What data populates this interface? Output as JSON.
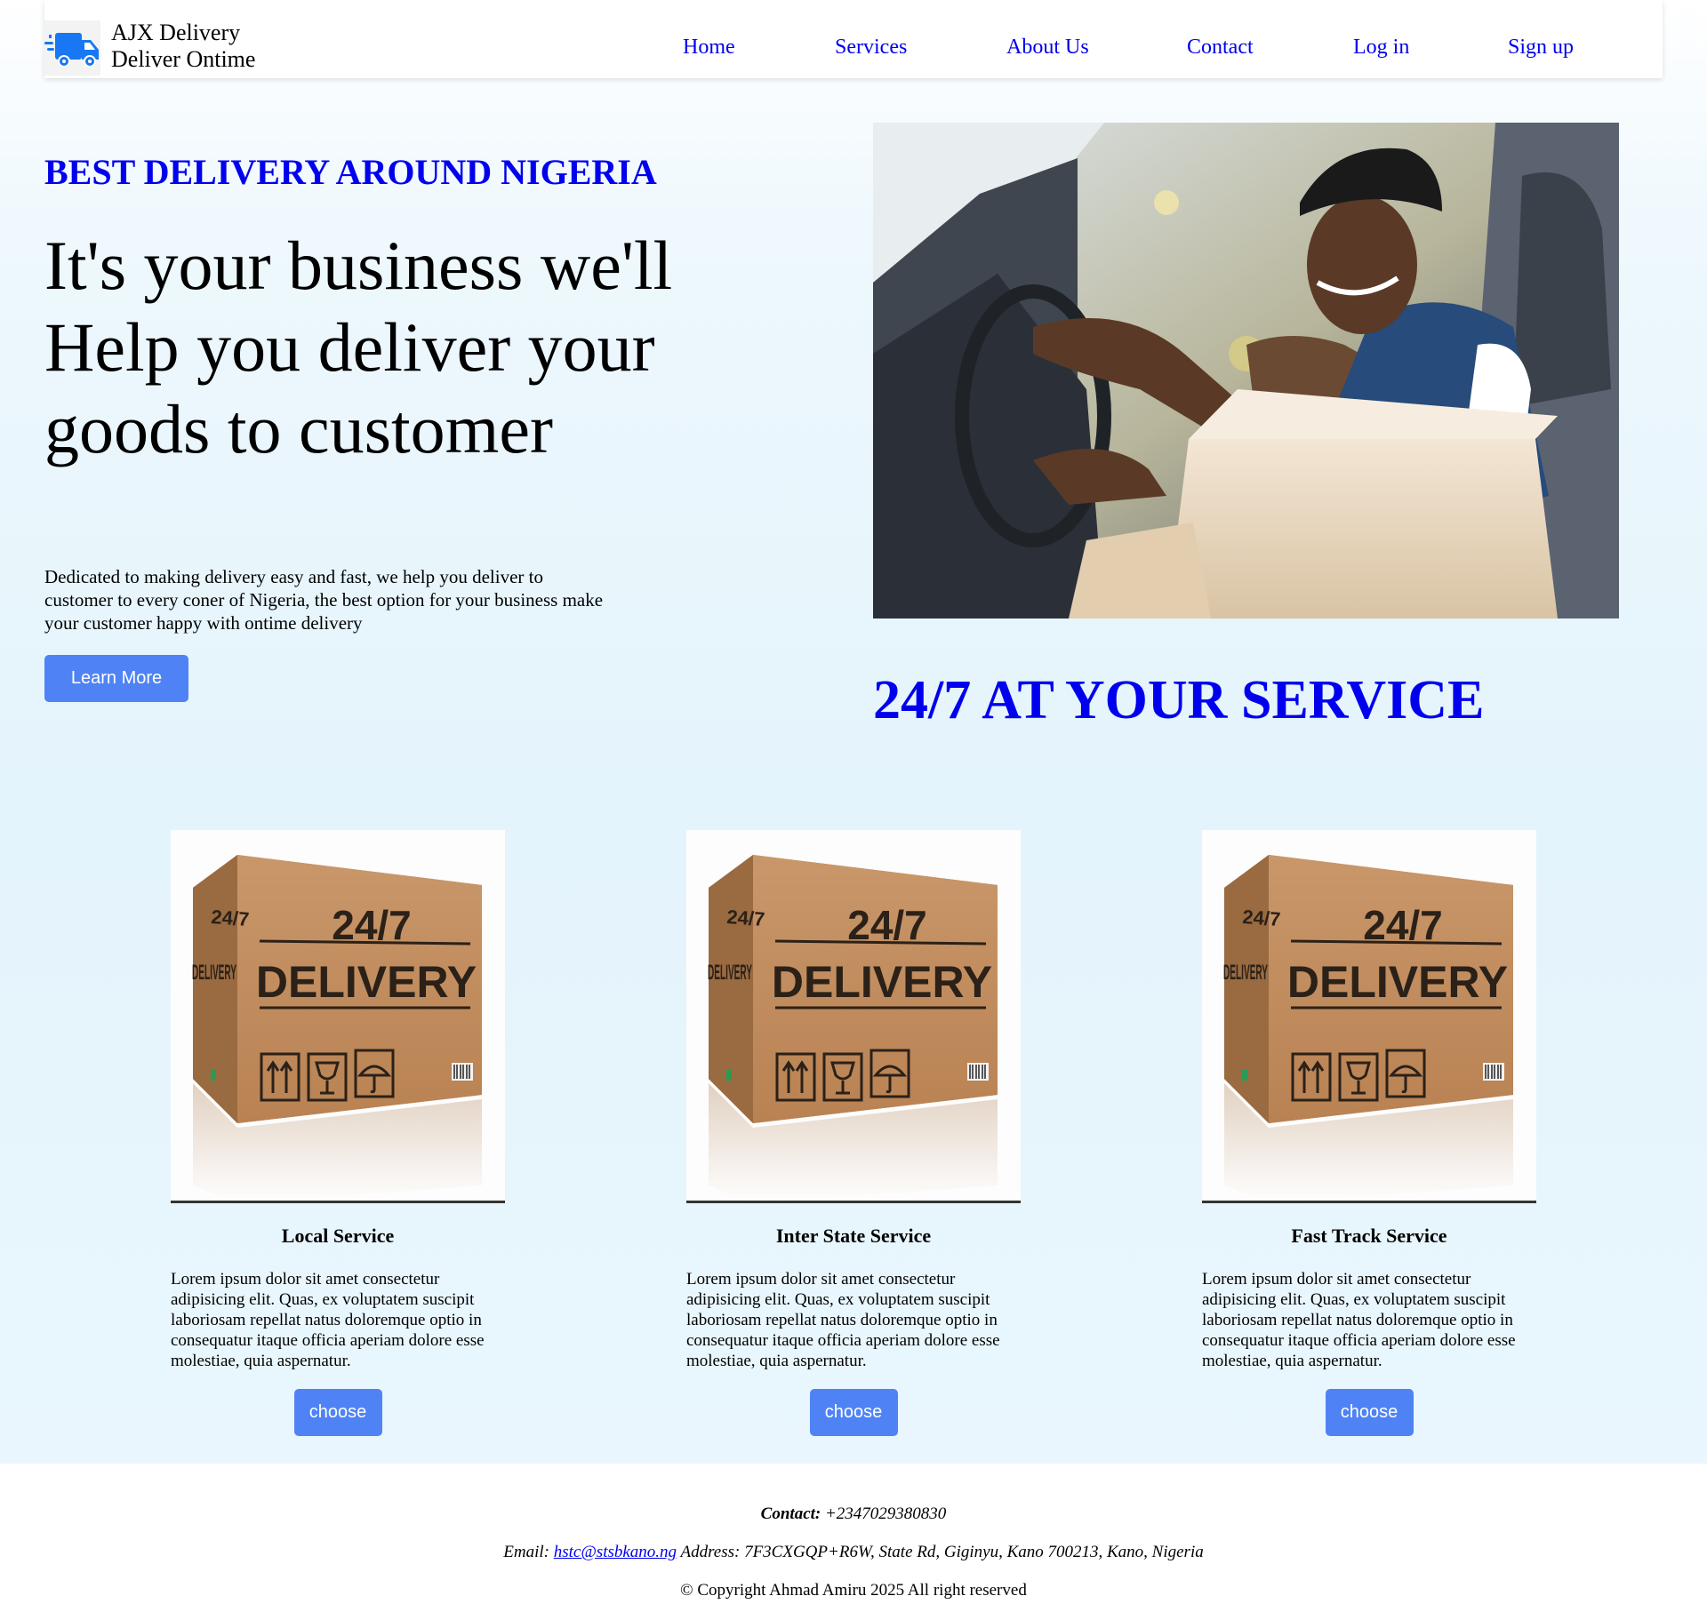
{
  "header": {
    "brand_line1": "AJX Delivery",
    "brand_line2": "Deliver Ontime",
    "nav": [
      "Home",
      "Services",
      "About Us",
      "Contact",
      "Log in",
      "Sign up"
    ]
  },
  "hero": {
    "eyebrow": "BEST DELIVERY AROUND NIGERIA",
    "title": "It's your business we'll Help you deliver your goods to customer",
    "text": "Dedicated to making delivery easy and fast, we help you deliver to customer to every coner of Nigeria, the best option for your business make your customer happy with ontime delivery",
    "button": "Learn More",
    "tagline": "24/7 AT YOUR SERVICE"
  },
  "box_image": {
    "top": "24/7",
    "main": "DELIVERY",
    "side_top": "24/7",
    "side_main": "DELIVERY"
  },
  "services": [
    {
      "title": "Local Service",
      "text": "Lorem ipsum dolor sit amet consectetur adipisicing elit. Quas, ex voluptatem suscipit laboriosam repellat natus doloremque optio in consequatur itaque officia aperiam dolore esse molestiae, quia aspernatur.",
      "button": "choose"
    },
    {
      "title": "Inter State Service",
      "text": "Lorem ipsum dolor sit amet consectetur adipisicing elit. Quas, ex voluptatem suscipit laboriosam repellat natus doloremque optio in consequatur itaque officia aperiam dolore esse molestiae, quia aspernatur.",
      "button": "choose"
    },
    {
      "title": "Fast Track Service",
      "text": "Lorem ipsum dolor sit amet consectetur adipisicing elit. Quas, ex voluptatem suscipit laboriosam repellat natus doloremque optio in consequatur itaque officia aperiam dolore esse molestiae, quia aspernatur.",
      "button": "choose"
    }
  ],
  "footer": {
    "contact_label": "Contact:",
    "contact_phone": "+2347029380830",
    "email_label": "Email:",
    "email": "hstc@stsbkano.ng",
    "address": "Address: 7F3CXGQP+R6W, State Rd, Giginyu, Kano 700213, Kano, Nigeria",
    "copyright": "© Copyright Ahmad Amiru 2025 All right reserved"
  },
  "colors": {
    "link": "#0000ee",
    "button": "#4f83f5",
    "logo": "#1877f2"
  },
  "icons": [
    "delivery-truck-icon",
    "up-arrows-icon",
    "fragile-glass-icon",
    "umbrella-icon",
    "barcode-icon"
  ]
}
